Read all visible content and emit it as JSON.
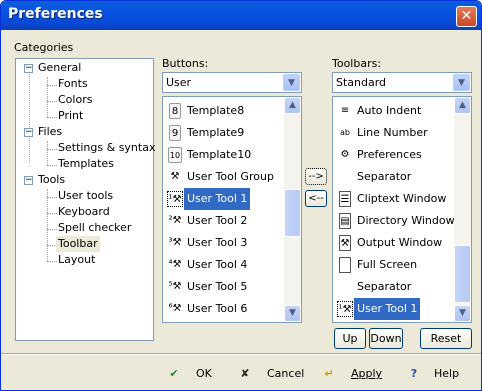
{
  "window": {
    "title": "Preferences"
  },
  "categories": {
    "label": "Categories",
    "tree": [
      {
        "label": "General",
        "expanded": true,
        "children": [
          "Fonts",
          "Colors",
          "Print"
        ]
      },
      {
        "label": "Files",
        "expanded": true,
        "children": [
          "Settings & syntax",
          "Templates"
        ]
      },
      {
        "label": "Tools",
        "expanded": true,
        "children": [
          "User tools",
          "Keyboard",
          "Spell checker",
          "Toolbar",
          "Layout"
        ]
      }
    ],
    "selected": "Toolbar"
  },
  "buttons_panel": {
    "label": "Buttons:",
    "combo_value": "User",
    "items": [
      {
        "icon": "8",
        "label": "Template8"
      },
      {
        "icon": "9",
        "label": "Template9"
      },
      {
        "icon": "10",
        "label": "Template10"
      },
      {
        "icon": "hammer-group",
        "label": "User Tool Group"
      },
      {
        "icon": "1",
        "label": "User Tool 1",
        "selected": true
      },
      {
        "icon": "2",
        "label": "User Tool 2"
      },
      {
        "icon": "3",
        "label": "User Tool 3"
      },
      {
        "icon": "4",
        "label": "User Tool 4"
      },
      {
        "icon": "5",
        "label": "User Tool 5"
      },
      {
        "icon": "6",
        "label": "User Tool 6"
      }
    ]
  },
  "transfer": {
    "add": "-->",
    "remove": "<--"
  },
  "toolbars_panel": {
    "label": "Toolbars:",
    "combo_value": "Standard",
    "items": [
      {
        "icon": "indent",
        "label": "Auto Indent"
      },
      {
        "icon": "line-number",
        "label": "Line Number"
      },
      {
        "icon": "preferences",
        "label": "Preferences"
      },
      {
        "icon": "",
        "label": "Separator"
      },
      {
        "icon": "cliptext",
        "label": "Cliptext Window"
      },
      {
        "icon": "directory",
        "label": "Directory Window"
      },
      {
        "icon": "output",
        "label": "Output Window"
      },
      {
        "icon": "fullscreen",
        "label": "Full Screen"
      },
      {
        "icon": "",
        "label": "Separator"
      },
      {
        "icon": "1",
        "label": "User Tool 1",
        "selected": true
      }
    ],
    "up": "Up",
    "down": "Down",
    "reset": "Reset"
  },
  "footer": {
    "ok": "OK",
    "cancel": "Cancel",
    "apply": "Apply",
    "help": "Help"
  },
  "colors": {
    "selection": "#316ac5",
    "titlebar": "#0953e4",
    "face": "#ece9d8"
  }
}
